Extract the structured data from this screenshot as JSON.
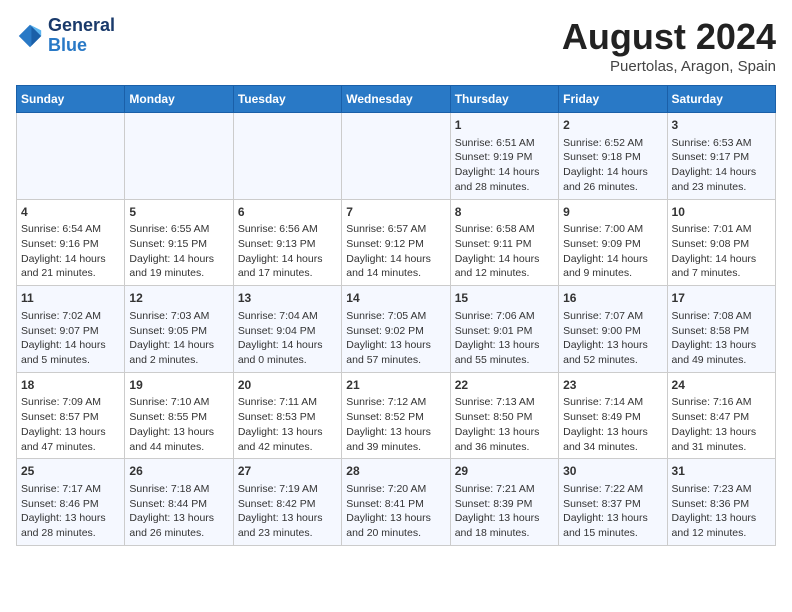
{
  "header": {
    "logo_general": "General",
    "logo_blue": "Blue",
    "month_year": "August 2024",
    "location": "Puertolas, Aragon, Spain"
  },
  "weekdays": [
    "Sunday",
    "Monday",
    "Tuesday",
    "Wednesday",
    "Thursday",
    "Friday",
    "Saturday"
  ],
  "weeks": [
    [
      {
        "day": "",
        "info": ""
      },
      {
        "day": "",
        "info": ""
      },
      {
        "day": "",
        "info": ""
      },
      {
        "day": "",
        "info": ""
      },
      {
        "day": "1",
        "info": "Sunrise: 6:51 AM\nSunset: 9:19 PM\nDaylight: 14 hours\nand 28 minutes."
      },
      {
        "day": "2",
        "info": "Sunrise: 6:52 AM\nSunset: 9:18 PM\nDaylight: 14 hours\nand 26 minutes."
      },
      {
        "day": "3",
        "info": "Sunrise: 6:53 AM\nSunset: 9:17 PM\nDaylight: 14 hours\nand 23 minutes."
      }
    ],
    [
      {
        "day": "4",
        "info": "Sunrise: 6:54 AM\nSunset: 9:16 PM\nDaylight: 14 hours\nand 21 minutes."
      },
      {
        "day": "5",
        "info": "Sunrise: 6:55 AM\nSunset: 9:15 PM\nDaylight: 14 hours\nand 19 minutes."
      },
      {
        "day": "6",
        "info": "Sunrise: 6:56 AM\nSunset: 9:13 PM\nDaylight: 14 hours\nand 17 minutes."
      },
      {
        "day": "7",
        "info": "Sunrise: 6:57 AM\nSunset: 9:12 PM\nDaylight: 14 hours\nand 14 minutes."
      },
      {
        "day": "8",
        "info": "Sunrise: 6:58 AM\nSunset: 9:11 PM\nDaylight: 14 hours\nand 12 minutes."
      },
      {
        "day": "9",
        "info": "Sunrise: 7:00 AM\nSunset: 9:09 PM\nDaylight: 14 hours\nand 9 minutes."
      },
      {
        "day": "10",
        "info": "Sunrise: 7:01 AM\nSunset: 9:08 PM\nDaylight: 14 hours\nand 7 minutes."
      }
    ],
    [
      {
        "day": "11",
        "info": "Sunrise: 7:02 AM\nSunset: 9:07 PM\nDaylight: 14 hours\nand 5 minutes."
      },
      {
        "day": "12",
        "info": "Sunrise: 7:03 AM\nSunset: 9:05 PM\nDaylight: 14 hours\nand 2 minutes."
      },
      {
        "day": "13",
        "info": "Sunrise: 7:04 AM\nSunset: 9:04 PM\nDaylight: 14 hours\nand 0 minutes."
      },
      {
        "day": "14",
        "info": "Sunrise: 7:05 AM\nSunset: 9:02 PM\nDaylight: 13 hours\nand 57 minutes."
      },
      {
        "day": "15",
        "info": "Sunrise: 7:06 AM\nSunset: 9:01 PM\nDaylight: 13 hours\nand 55 minutes."
      },
      {
        "day": "16",
        "info": "Sunrise: 7:07 AM\nSunset: 9:00 PM\nDaylight: 13 hours\nand 52 minutes."
      },
      {
        "day": "17",
        "info": "Sunrise: 7:08 AM\nSunset: 8:58 PM\nDaylight: 13 hours\nand 49 minutes."
      }
    ],
    [
      {
        "day": "18",
        "info": "Sunrise: 7:09 AM\nSunset: 8:57 PM\nDaylight: 13 hours\nand 47 minutes."
      },
      {
        "day": "19",
        "info": "Sunrise: 7:10 AM\nSunset: 8:55 PM\nDaylight: 13 hours\nand 44 minutes."
      },
      {
        "day": "20",
        "info": "Sunrise: 7:11 AM\nSunset: 8:53 PM\nDaylight: 13 hours\nand 42 minutes."
      },
      {
        "day": "21",
        "info": "Sunrise: 7:12 AM\nSunset: 8:52 PM\nDaylight: 13 hours\nand 39 minutes."
      },
      {
        "day": "22",
        "info": "Sunrise: 7:13 AM\nSunset: 8:50 PM\nDaylight: 13 hours\nand 36 minutes."
      },
      {
        "day": "23",
        "info": "Sunrise: 7:14 AM\nSunset: 8:49 PM\nDaylight: 13 hours\nand 34 minutes."
      },
      {
        "day": "24",
        "info": "Sunrise: 7:16 AM\nSunset: 8:47 PM\nDaylight: 13 hours\nand 31 minutes."
      }
    ],
    [
      {
        "day": "25",
        "info": "Sunrise: 7:17 AM\nSunset: 8:46 PM\nDaylight: 13 hours\nand 28 minutes."
      },
      {
        "day": "26",
        "info": "Sunrise: 7:18 AM\nSunset: 8:44 PM\nDaylight: 13 hours\nand 26 minutes."
      },
      {
        "day": "27",
        "info": "Sunrise: 7:19 AM\nSunset: 8:42 PM\nDaylight: 13 hours\nand 23 minutes."
      },
      {
        "day": "28",
        "info": "Sunrise: 7:20 AM\nSunset: 8:41 PM\nDaylight: 13 hours\nand 20 minutes."
      },
      {
        "day": "29",
        "info": "Sunrise: 7:21 AM\nSunset: 8:39 PM\nDaylight: 13 hours\nand 18 minutes."
      },
      {
        "day": "30",
        "info": "Sunrise: 7:22 AM\nSunset: 8:37 PM\nDaylight: 13 hours\nand 15 minutes."
      },
      {
        "day": "31",
        "info": "Sunrise: 7:23 AM\nSunset: 8:36 PM\nDaylight: 13 hours\nand 12 minutes."
      }
    ]
  ]
}
